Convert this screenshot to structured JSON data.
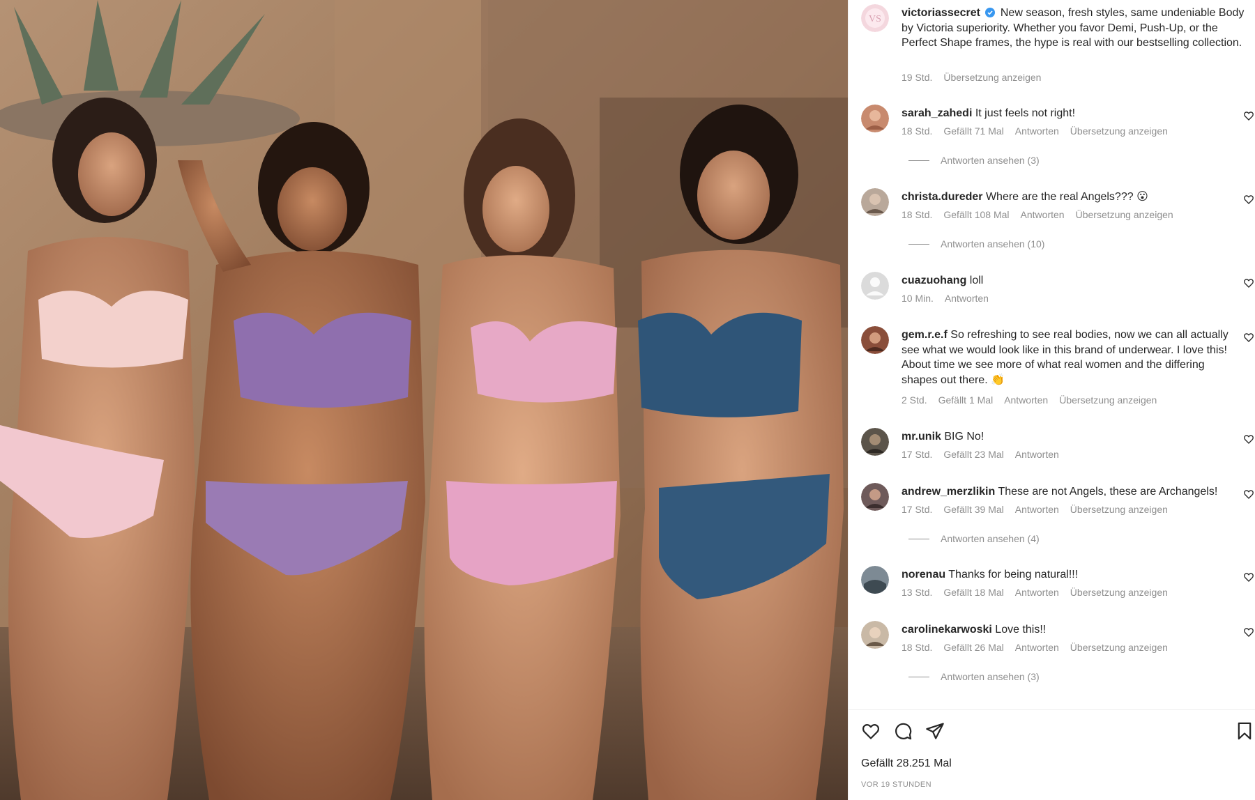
{
  "post": {
    "photo": {
      "description_icon": "photo-image"
    },
    "caption": {
      "username": "victoriassecret",
      "verified_icon": "verified-badge-icon",
      "text": "New season, fresh styles, same undeniable Body by Victoria superiority. Whether you favor Demi, Push-Up, or the Perfect Shape frames, the hype is real with our bestselling collection.",
      "time": "19 Std.",
      "translate": "Übersetzung anzeigen"
    },
    "comments": [
      {
        "user": "sarah_zahedi",
        "text": "It just feels not right!",
        "time": "18 Std.",
        "likes": "Gefällt 71 Mal",
        "reply": "Antworten",
        "translate": "Übersetzung anzeigen",
        "view_replies": "Antworten ansehen (3)"
      },
      {
        "user": "christa.dureder",
        "text": "Where are the real Angels??? 😮",
        "time": "18 Std.",
        "likes": "Gefällt 108 Mal",
        "reply": "Antworten",
        "translate": "Übersetzung anzeigen",
        "view_replies": "Antworten ansehen (10)"
      },
      {
        "user": "cuazuohang",
        "text": "loll",
        "time": "10 Min.",
        "reply": "Antworten"
      },
      {
        "user": "gem.r.e.f",
        "text": "So refreshing to see real bodies, now we can all actually see what we would look like in this brand of underwear. I love this! About time we see more of what real women and the differing shapes out there. 👏",
        "time": "2 Std.",
        "likes": "Gefällt 1 Mal",
        "reply": "Antworten",
        "translate": "Übersetzung anzeigen"
      },
      {
        "user": "mr.unik",
        "text": "BIG No!",
        "time": "17 Std.",
        "likes": "Gefällt 23 Mal",
        "reply": "Antworten"
      },
      {
        "user": "andrew_merzlikin",
        "text": "These are not Angels, these are Archangels!",
        "time": "17 Std.",
        "likes": "Gefällt 39 Mal",
        "reply": "Antworten",
        "translate": "Übersetzung anzeigen",
        "view_replies": "Antworten ansehen (4)"
      },
      {
        "user": "norenau",
        "text": "Thanks for being natural!!!",
        "time": "13 Std.",
        "likes": "Gefällt 18 Mal",
        "reply": "Antworten",
        "translate": "Übersetzung anzeigen"
      },
      {
        "user": "carolinekarwoski",
        "text": "Love this!!",
        "time": "18 Std.",
        "likes": "Gefällt 26 Mal",
        "reply": "Antworten",
        "translate": "Übersetzung anzeigen",
        "view_replies": "Antworten ansehen (3)"
      }
    ],
    "footer": {
      "likes": "Gefällt 28.251 Mal",
      "time": "VOR 19 STUNDEN",
      "icons": [
        "heart-icon",
        "comment-icon",
        "share-icon",
        "bookmark-icon"
      ]
    },
    "colors": {
      "verified": "#3897f0",
      "meta_text": "#8e8e8e",
      "text": "#262626"
    }
  }
}
